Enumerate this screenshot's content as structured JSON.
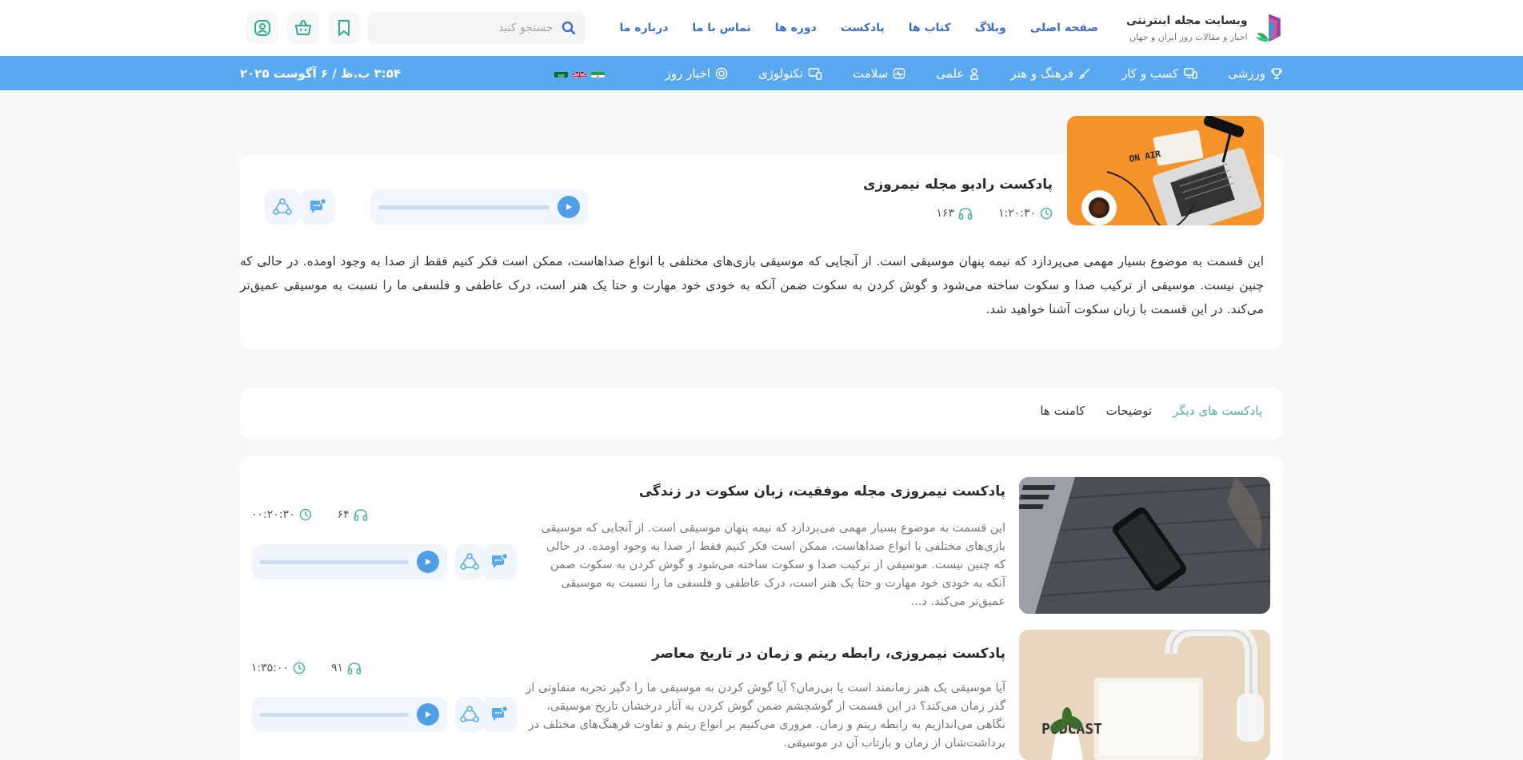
{
  "header": {
    "site_title": "وبسایت مجله اینترنتی",
    "site_subtitle": "اخبار و مقالات روز ایران و جهان",
    "nav": [
      {
        "label": "صفحه اصلی"
      },
      {
        "label": "وبلاگ"
      },
      {
        "label": "کتاب ها"
      },
      {
        "label": "پادکست"
      },
      {
        "label": "دوره ها"
      },
      {
        "label": "تماس با ما"
      },
      {
        "label": "درباره ما"
      }
    ],
    "search_placeholder": "جستجو کنید",
    "icons": [
      "bookmark-icon",
      "basket-icon",
      "user-icon"
    ],
    "accent": "#3c6fd1"
  },
  "catbar": {
    "bg": "#5aa9f0",
    "items": [
      {
        "label": "ورزشی",
        "icon": "trophy-icon"
      },
      {
        "label": "کسب و کار",
        "icon": "monitor-icon"
      },
      {
        "label": "فرهنگ و هنر",
        "icon": "brush-icon"
      },
      {
        "label": "علمی",
        "icon": "science-icon"
      },
      {
        "label": "سلامت",
        "icon": "heart-monitor-icon"
      },
      {
        "label": "تکنولوژی",
        "icon": "devices-icon"
      },
      {
        "label": "اخبار روز",
        "icon": "news-icon"
      }
    ],
    "flags": [
      "ir-flag",
      "gb-flag",
      "sa-flag"
    ],
    "datetime": "۳:۵۴ ب.ظ / ۶ آگوست ۲۰۲۵"
  },
  "hero": {
    "title": "پادکست رادیو مجله نیمروزی",
    "duration": "۱:۲۰:۳۰",
    "listens": "۱۶۳",
    "description": "این قسمت به موضوع بسیار مهمی می‌پردازد که نیمه پنهان موسیقی است. از آنجایی که موسیقی بازی‌های مختلفی با انواع صداهاست، ممکن است فکر کنیم فقط از صدا به وجود اومده. در حالی که چنین نیست. موسیقی از ترکیب صدا و سکوت ساخته می‌شود و گوش کردن به سکوت ضمن آنکه به خودی خود مهارت و حتا یک هنر است، درک عاطفی و فلسفی ما را نسبت به موسیقی عمیق‌تر می‌کند. در این قسمت با زبان سکوت آشنا خواهید شد."
  },
  "tabs": [
    {
      "label": "پادکست های دیگر",
      "active": true
    },
    {
      "label": "توضیحات",
      "active": false
    },
    {
      "label": "کامنت ها",
      "active": false
    }
  ],
  "items": [
    {
      "title": "پادکست نیمروزی مجله موفقیت، زبان سکوت در زندگی",
      "description": "این قسمت به موضوع بسیار مهمی می‌پردازد که نیمه پنهان موسیقی است. از آنجایی که موسیقی بازی‌های مختلفی با انواع صداهاست، ممکن است فکر کنیم فقط از صدا به وجود اومده. در حالی که چنین نیست. موسیقی از ترکیب صدا و سکوت ساخته می‌شود و گوش کردن به سکوت ضمن آنکه به خودی خود مهارت و حتا یک هنر است، درک عاطفی و فلسفی ما را نسبت به موسیقی عمیق‌تر می‌کند. د...",
      "duration": "۰۰:۲۰:۳۰",
      "listens": "۶۴"
    },
    {
      "title": "پادکست نیمروزی، رابطه ریتم و زمان در تاریخ معاصر",
      "description": "آیا موسیقی یک هنر زمانمند است یا بی‌زمان؟ آیا گوش کردن به موسیقی ما را دگیر تجربه متفاوتی از گذر زمان می‌کند؟ در این قسمت از گوشچشم ضمن گوش کردن به آثار درخشان تاریخ موسیقی، نگاهی می‌اندازیم به رابطه ریتم و زمان. مروری می‌کنیم بر انواع ریتم و تفاوت فرهنگ‌های مختلف در برداشت‌شان از زمان و بازتاب آن در موسیقی.",
      "duration": "۱:۳۵:۰۰",
      "listens": "۹۱"
    }
  ],
  "colors": {
    "green": "#4cb89a",
    "play": "#4f9ee8",
    "player_bg": "#f0f5fb"
  }
}
